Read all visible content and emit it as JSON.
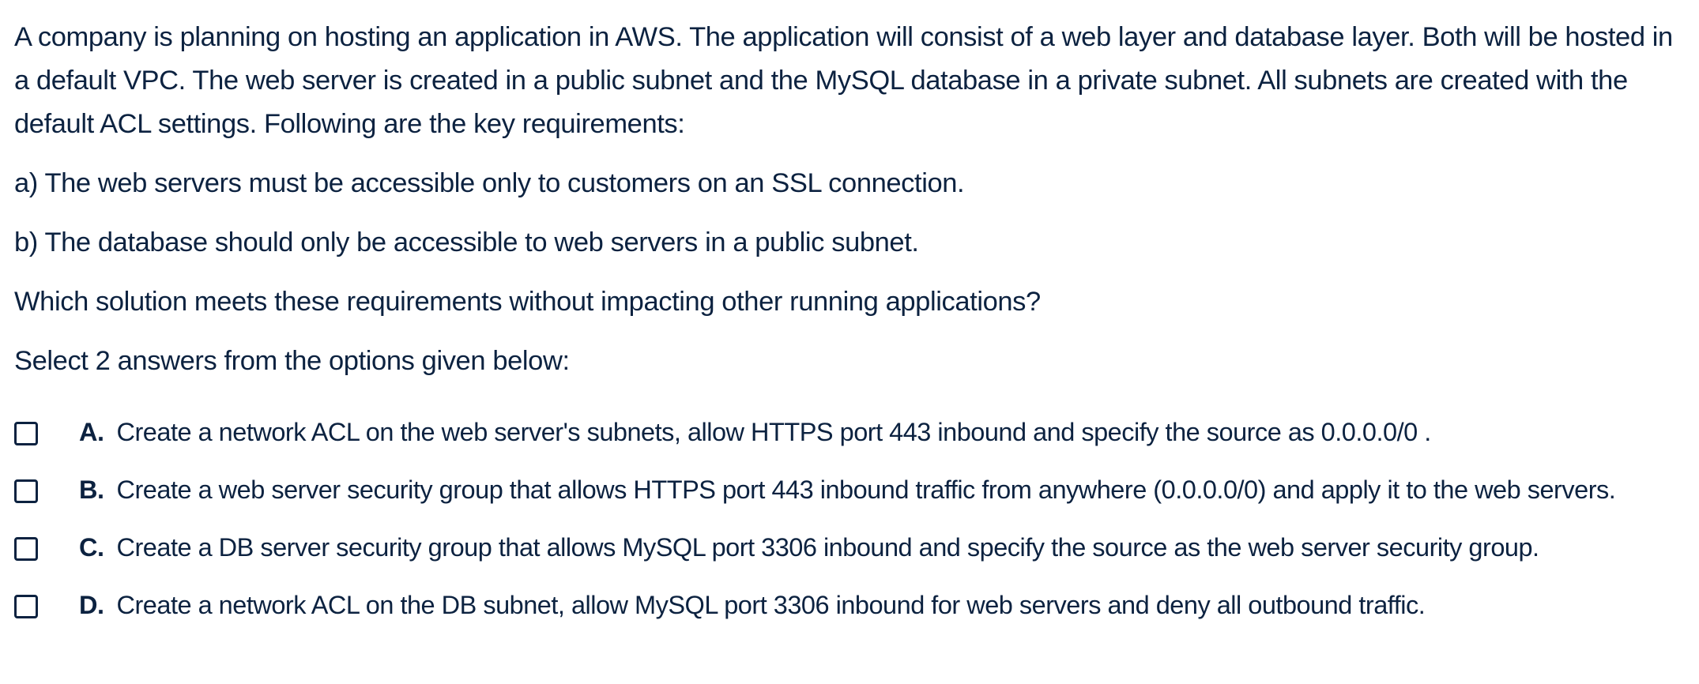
{
  "question": {
    "paragraphs": [
      "A company is planning on hosting an application in AWS. The application will consist of a web layer and database layer. Both will be hosted in a default VPC. The web server is created in a public subnet and the MySQL database in a private subnet. All subnets are created with the default ACL settings. Following are the key requirements:",
      "a) The web servers must be accessible only to customers on an SSL connection.",
      "b) The database should only be accessible to web servers in a public subnet.",
      "Which solution meets these requirements without impacting other running applications?",
      "Select 2 answers from the options given below:"
    ]
  },
  "options": [
    {
      "letter": "A.",
      "text": "Create a network ACL on the web server's subnets, allow HTTPS port 443 inbound and specify the source as 0.0.0.0/0 .",
      "checked": false
    },
    {
      "letter": "B.",
      "text": "Create a web server security group that allows HTTPS port 443 inbound traffic from anywhere (0.0.0.0/0) and apply it to the web servers.",
      "checked": false
    },
    {
      "letter": "C.",
      "text": "Create a DB server security group that allows MySQL port 3306 inbound and specify the source as the web server security group.",
      "checked": false
    },
    {
      "letter": "D.",
      "text": "Create a network ACL on the DB subnet, allow MySQL port 3306 inbound for web servers and deny all outbound traffic.",
      "checked": false
    }
  ],
  "colors": {
    "text": "#0c2240",
    "background": "#ffffff"
  },
  "icons": {
    "checkbox": "checkbox-empty-icon"
  }
}
